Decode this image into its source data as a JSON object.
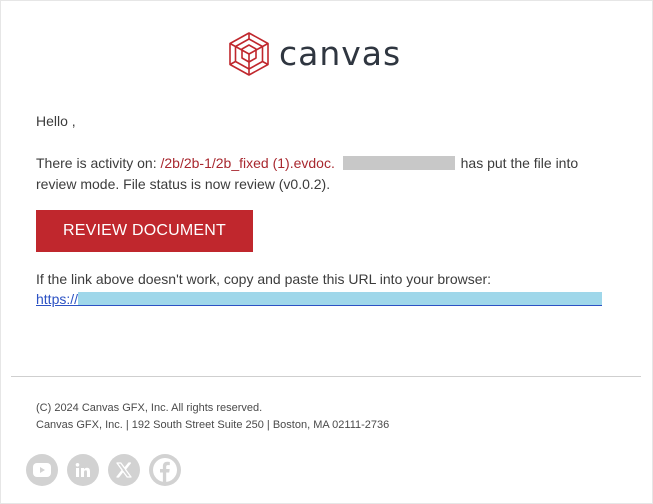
{
  "brand": {
    "name": "canvas",
    "logo_icon": "cube-hexagon-icon",
    "accent_color": "#c0272d"
  },
  "message": {
    "greeting": "Hello ,",
    "activity_prefix": "There is activity on:",
    "file_path": "/2b/2b-1/2b_fixed (1).evdoc.",
    "activity_suffix": "has put the file into review mode. File status is now review (v0.0.2).",
    "button_label": "REVIEW DOCUMENT",
    "url_note": "If the link above doesn't work, copy and paste this URL into your browser:",
    "url_prefix": "https://"
  },
  "footer": {
    "copyright": "(C) 2024 Canvas GFX, Inc. All rights reserved.",
    "address": "Canvas GFX, Inc. | 192 South Street Suite 250 | Boston, MA 02111-2736",
    "social": [
      {
        "icon": "youtube-icon"
      },
      {
        "icon": "linkedin-icon"
      },
      {
        "icon": "x-icon"
      },
      {
        "icon": "facebook-icon"
      }
    ]
  }
}
